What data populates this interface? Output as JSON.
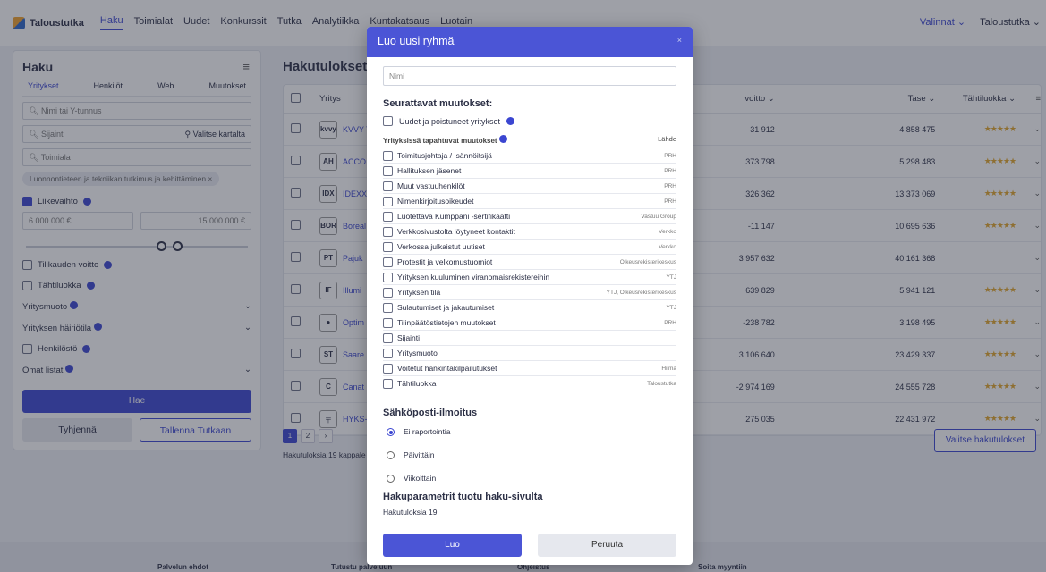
{
  "nav": {
    "brand": "Taloustutka",
    "links": [
      "Haku",
      "Toimialat",
      "Uudet",
      "Konkurssit",
      "Tutka",
      "Analytiikka",
      "Kuntakatsaus",
      "Luotain"
    ],
    "right_menu": "Valinnat",
    "right_user": "Taloustutka"
  },
  "left": {
    "title": "Haku",
    "tabs": [
      "Yritykset",
      "Henkilöt",
      "Web",
      "Muutokset"
    ],
    "name_placeholder": "Nimi tai Y-tunnus",
    "location_placeholder": "Sijainti",
    "map_button": "Valitse kartalta",
    "industry_placeholder": "Toimiala",
    "chip": "Luonnontieteen ja tekniikan tutkimus ja kehittäminen",
    "revenue_label": "Liikevaihto",
    "revenue_min": "6 000 000 €",
    "revenue_max": "15 000 000 €",
    "profit_label": "Tilikauden voitto",
    "rating_label": "Tähtiluokka",
    "form_label": "Yritysmuoto",
    "disturb_label": "Yrityksen häiriötila",
    "staff_label": "Henkilöstö",
    "lists_label": "Omat listat",
    "search_button": "Hae",
    "clear_button": "Tyhjennä",
    "save_button": "Tallenna Tutkaan"
  },
  "results": {
    "title": "Hakutulokset",
    "col_company": "Yritys",
    "col_profit": "voitto",
    "col_balance": "Tase",
    "col_rating": "Tähtiluokka",
    "rows": [
      {
        "logo": "kvvy",
        "name": "KVVY T",
        "profit": "31 912",
        "balance": "4 858 475",
        "stars": "★★★★★"
      },
      {
        "logo": "AH",
        "name": "ACCO",
        "profit": "373 798",
        "balance": "5 298 483",
        "stars": "★★★★★"
      },
      {
        "logo": "IDX",
        "name": "IDEXX",
        "profit": "326 362",
        "balance": "13 373 069",
        "stars": "★★★★★"
      },
      {
        "logo": "BOR",
        "name": "Boreal",
        "profit": "-11 147",
        "balance": "10 695 636",
        "stars": "★★★★★"
      },
      {
        "logo": "PT",
        "name": "Pajuk",
        "profit": "3 957 632",
        "balance": "40 161 368",
        "stars": ""
      },
      {
        "logo": "IF",
        "name": "Illumi",
        "profit": "639 829",
        "balance": "5 941 121",
        "stars": "★★★★★"
      },
      {
        "logo": "●",
        "name": "Optim",
        "profit": "-238 782",
        "balance": "3 198 495",
        "stars": "★★★★★"
      },
      {
        "logo": "ST",
        "name": "Saare",
        "profit": "3 106 640",
        "balance": "23 429 337",
        "stars": "★★★★★"
      },
      {
        "logo": "C",
        "name": "Canat",
        "profit": "-2 974 169",
        "balance": "24 555 728",
        "stars": "★★★★★"
      },
      {
        "logo": "╤",
        "name": "HYKS-",
        "profit": "275 035",
        "balance": "22 431 972",
        "stars": "★★★★★"
      }
    ],
    "pages": [
      "1",
      "2",
      "›"
    ],
    "count": "Hakutuloksia 19 kappale",
    "select_button": "Valitse hakutulokset"
  },
  "footer": {
    "links": [
      "Palvelun ehdot",
      "Tutustu palveluun",
      "Ohjeistus",
      "Soita myyntiin"
    ]
  },
  "modal": {
    "title": "Luo uusi ryhmä",
    "close": "×",
    "name_placeholder": "Nimi",
    "changes_title": "Seurattavat muutokset:",
    "new_removed": "Uudet ja poistuneet yritykset",
    "company_changes": "Yrityksissä tapahtuvat muutokset",
    "source_header": "Lähde",
    "items": [
      {
        "label": "Toimitusjohtaja / Isännöitsijä",
        "source": "PRH"
      },
      {
        "label": "Hallituksen jäsenet",
        "source": "PRH"
      },
      {
        "label": "Muut vastuuhenkilöt",
        "source": "PRH"
      },
      {
        "label": "Nimenkirjoitusoikeudet",
        "source": "PRH"
      },
      {
        "label": "Luotettava Kumppani -sertifikaatti",
        "source": "Vastuu Group"
      },
      {
        "label": "Verkkosivustolta löytyneet kontaktit",
        "source": "Verkko"
      },
      {
        "label": "Verkossa julkaistut uutiset",
        "source": "Verkko"
      },
      {
        "label": "Protestit ja velkomustuomiot",
        "source": "Oikeusrekisterikeskus"
      },
      {
        "label": "Yrityksen kuuluminen viranomaisrekistereihin",
        "source": "YTJ"
      },
      {
        "label": "Yrityksen tila",
        "source": "YTJ, Oikeusrekisterikeskus"
      },
      {
        "label": "Sulautumiset ja jakautumiset",
        "source": "YTJ"
      },
      {
        "label": "Tilinpäätöstietojen muutokset",
        "source": "PRH"
      },
      {
        "label": "Sijainti",
        "source": ""
      },
      {
        "label": "Yritysmuoto",
        "source": ""
      },
      {
        "label": "Voitetut hankintakilpailutukset",
        "source": "Hilma"
      },
      {
        "label": "Tähtiluokka",
        "source": "Taloustutka"
      }
    ],
    "email_title": "Sähköposti-ilmoitus",
    "email_options": [
      "Ei raportointia",
      "Päivittäin",
      "Viikoittain"
    ],
    "params_title": "Hakuparametrit tuotu haku-sivulta",
    "params_count": "Hakutuloksia 19",
    "create_button": "Luo",
    "cancel_button": "Peruuta"
  }
}
